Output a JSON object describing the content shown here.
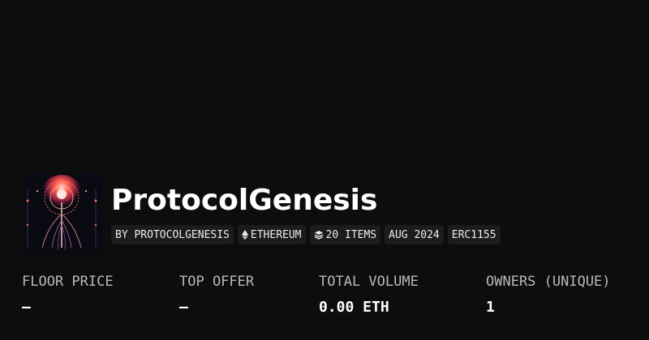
{
  "collection": {
    "name": "ProtocolGenesis",
    "avatar_icon": "neural-tree-artwork"
  },
  "tags": {
    "creator": "BY PROTOCOLGENESIS",
    "chain": "ETHEREUM",
    "chain_icon": "ethereum-diamond-icon",
    "items": "20 ITEMS",
    "items_icon": "layers-icon",
    "date": "AUG 2024",
    "standard": "ERC1155"
  },
  "stats": {
    "floor_price": {
      "label": "FLOOR PRICE",
      "value": "—"
    },
    "top_offer": {
      "label": "TOP OFFER",
      "value": "—"
    },
    "total_volume": {
      "label": "TOTAL VOLUME",
      "value": "0.00 ETH"
    },
    "owners": {
      "label": "OWNERS (UNIQUE)",
      "value": "1"
    }
  },
  "colors": {
    "background": "#0d0d0e",
    "tag_background": "#1c1c1e",
    "label_text": "#b9b9bb",
    "avatar_accent": "#ff6a5c"
  }
}
